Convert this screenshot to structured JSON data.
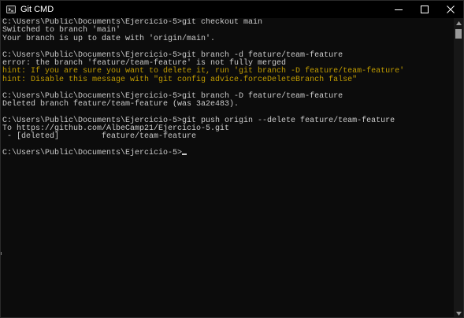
{
  "window": {
    "title": "Git CMD"
  },
  "console": {
    "lines": [
      {
        "text": "C:\\Users\\Public\\Documents\\Ejercicio-5>git checkout main",
        "kind": "normal"
      },
      {
        "text": "Switched to branch 'main'",
        "kind": "normal"
      },
      {
        "text": "Your branch is up to date with 'origin/main'.",
        "kind": "normal"
      },
      {
        "text": "",
        "kind": "normal"
      },
      {
        "text": "C:\\Users\\Public\\Documents\\Ejercicio-5>git branch -d feature/team-feature",
        "kind": "normal"
      },
      {
        "text": "error: the branch 'feature/team-feature' is not fully merged",
        "kind": "normal"
      },
      {
        "text": "hint: If you are sure you want to delete it, run 'git branch -D feature/team-feature'",
        "kind": "hint"
      },
      {
        "text": "hint: Disable this message with \"git config advice.forceDeleteBranch false\"",
        "kind": "hint"
      },
      {
        "text": "",
        "kind": "normal"
      },
      {
        "text": "C:\\Users\\Public\\Documents\\Ejercicio-5>git branch -D feature/team-feature",
        "kind": "normal"
      },
      {
        "text": "Deleted branch feature/team-feature (was 3a2e483).",
        "kind": "normal"
      },
      {
        "text": "",
        "kind": "normal"
      },
      {
        "text": "C:\\Users\\Public\\Documents\\Ejercicio-5>git push origin --delete feature/team-feature",
        "kind": "normal"
      },
      {
        "text": "To https://github.com/AlbeCamp21/Ejercicio-5.git",
        "kind": "normal"
      },
      {
        "text": " - [deleted]         feature/team-feature",
        "kind": "normal"
      },
      {
        "text": "",
        "kind": "normal"
      },
      {
        "text": "C:\\Users\\Public\\Documents\\Ejercicio-5>",
        "kind": "prompt"
      }
    ]
  },
  "colors": {
    "background": "#0c0c0c",
    "text": "#cccccc",
    "hint": "#c19c00",
    "titlebar": "#000000"
  },
  "icons": {
    "app": "git-cmd-icon",
    "minimize": "minimize-icon",
    "maximize": "maximize-icon",
    "close": "close-icon",
    "scroll_up": "chevron-up-icon",
    "scroll_down": "chevron-down-icon"
  }
}
